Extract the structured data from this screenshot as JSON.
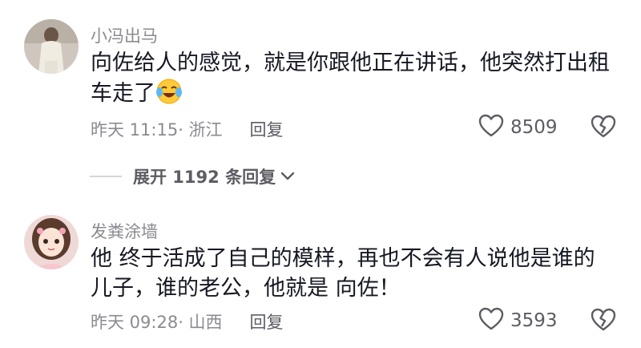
{
  "comments": [
    {
      "username": "小冯出马",
      "text_line1": "向佐给人的感觉，就是你跟他正在讲话，他突然打出租",
      "text_line2": "车走了",
      "emoji": "laughing-crying-emoji",
      "time_location": "昨天 11:15· 浙江",
      "reply_label": "回复",
      "likes": "8509"
    },
    {
      "username": "发粪涂墙",
      "text_line1": "他 终于活成了自己的模样，再也不会有人说他是谁的",
      "text_line2": "儿子，谁的老公，他就是 向佐！",
      "time_location": "昨天 09:28· 山西",
      "reply_label": "回复",
      "likes": "3593"
    }
  ],
  "expand_replies": {
    "label": "展开 1192 条回复"
  },
  "icons": {
    "like": "heart-outline-icon",
    "dislike": "broken-heart-icon",
    "expand": "chevron-down-icon"
  }
}
